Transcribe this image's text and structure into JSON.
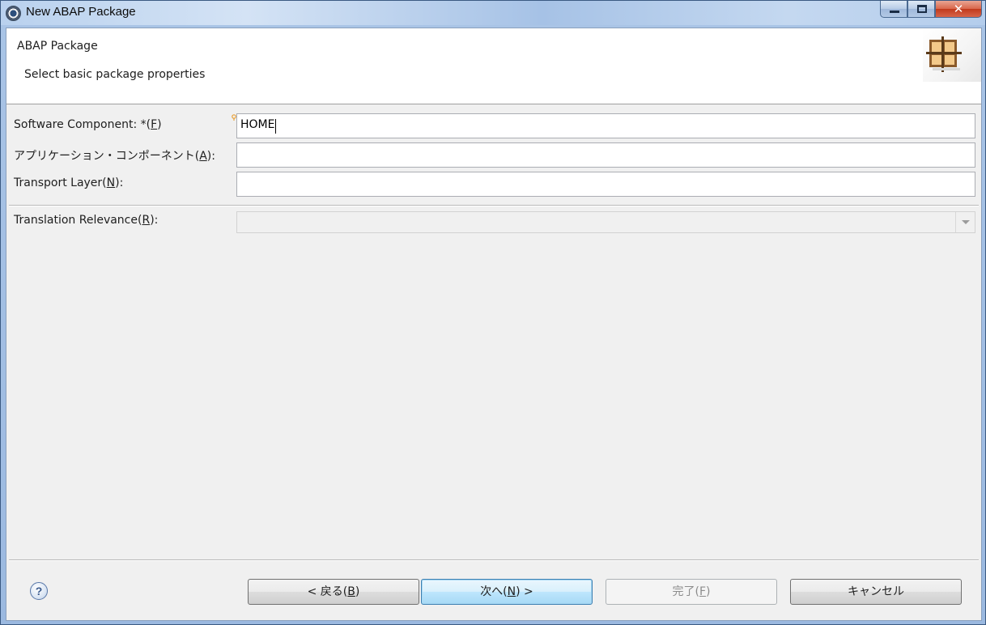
{
  "window": {
    "title": "New ABAP Package",
    "close_symbol": "✕"
  },
  "header": {
    "title": "ABAP Package",
    "description": "Select basic package properties"
  },
  "form": {
    "software_component": {
      "label_pre": "Software Component: *(",
      "label_key": "F",
      "label_post": ")",
      "value": "HOME"
    },
    "application_component": {
      "label_pre": "アプリケーション・コンポーネント(",
      "label_key": "A",
      "label_post": "):",
      "value": ""
    },
    "transport_layer": {
      "label_pre": "Transport Layer(",
      "label_key": "N",
      "label_post": "):",
      "value": ""
    },
    "translation_relevance": {
      "label_pre": "Translation Relevance(",
      "label_key": "R",
      "label_post": "):",
      "value": ""
    }
  },
  "buttons": {
    "help": "?",
    "back": {
      "pre": "< 戻る(",
      "key": "B",
      "post": ")"
    },
    "next": {
      "pre": "次へ(",
      "key": "N",
      "post": ") >"
    },
    "finish": {
      "pre": "完了(",
      "key": "F",
      "post": ")"
    },
    "cancel": "キャンセル"
  },
  "colors": {
    "dialog_bg": "#f0f0f0",
    "header_bg": "#ffffff",
    "default_button_border": "#3c7fb1",
    "disabled_text": "#8c8c8c"
  },
  "icons": {
    "title": "eclipse-gear-icon",
    "header": "abap-package-icon",
    "help": "help-icon",
    "hint": "content-assist-bulb-icon",
    "combo": "chevron-down-icon"
  }
}
